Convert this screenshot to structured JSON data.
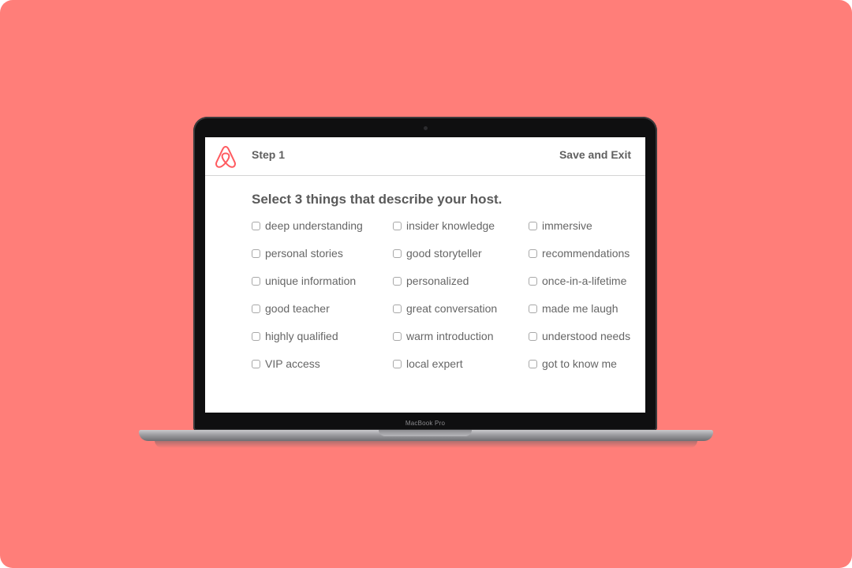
{
  "header": {
    "step_label": "Step 1",
    "save_exit_label": "Save and Exit",
    "logo_icon": "airbnb-logo-icon"
  },
  "prompt": "Select 3 things that describe your host.",
  "options": {
    "col1": [
      "deep understanding",
      "personal stories",
      "unique information",
      "good teacher",
      "highly qualified",
      "VIP access"
    ],
    "col2": [
      "insider knowledge",
      "good storyteller",
      "personalized",
      "great conversation",
      "warm introduction",
      "local expert"
    ],
    "col3": [
      "immersive",
      "recommendations",
      "once-in-a-lifetime",
      "made me laugh",
      "understood needs",
      "got to know me"
    ]
  },
  "device_label": "MacBook Pro",
  "colors": {
    "background": "#ff7e79",
    "brand": "#ff5a5f",
    "text": "#5a5a5a"
  }
}
